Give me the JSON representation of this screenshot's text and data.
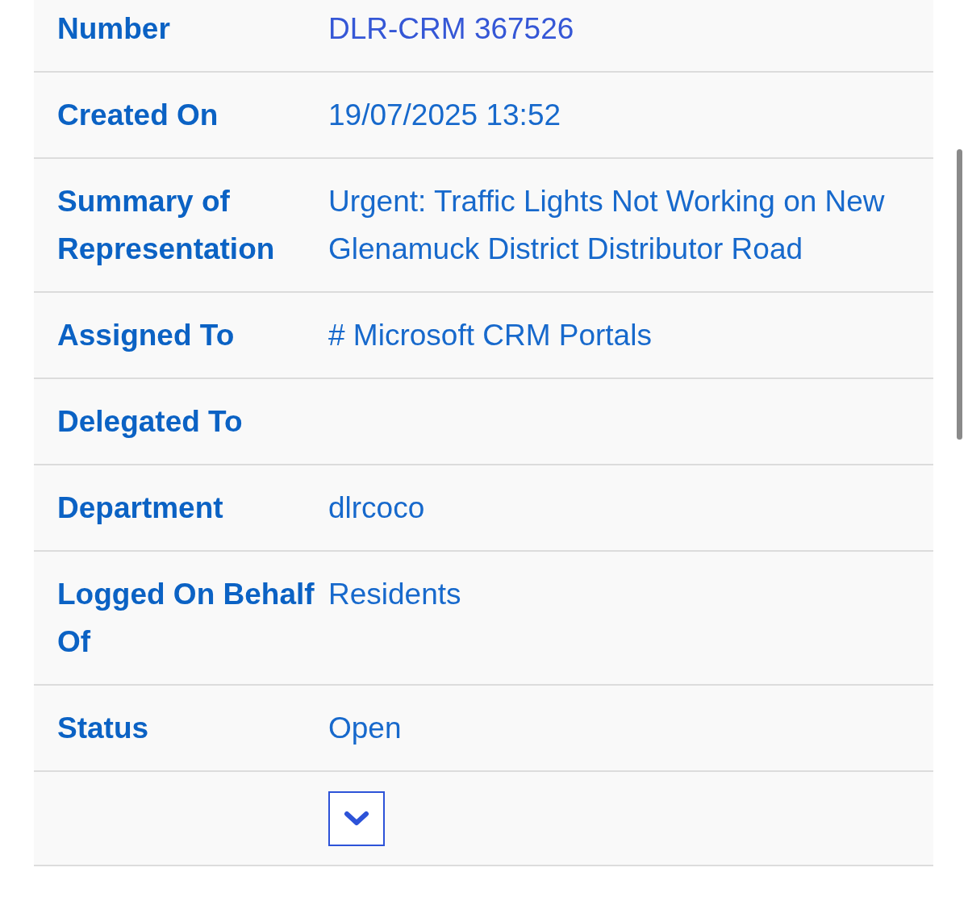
{
  "details": {
    "rows": [
      {
        "kind": "link",
        "label": "Number",
        "value": "DLR-CRM 367526"
      },
      {
        "kind": "text",
        "label": "Created On",
        "value": "19/07/2025 13:52"
      },
      {
        "kind": "text",
        "label": "Summary of Representation",
        "value": "Urgent: Traffic Lights Not Working on New Glenamuck District Distributor Road"
      },
      {
        "kind": "text",
        "label": "Assigned To",
        "value": "# Microsoft CRM Portals"
      },
      {
        "kind": "text",
        "label": "Delegated To"
      },
      {
        "kind": "text",
        "label": "Department",
        "value": "dlrcoco"
      },
      {
        "kind": "text",
        "label": "Logged On Behalf Of",
        "value": "Residents"
      },
      {
        "kind": "text",
        "label": "Status",
        "value": "Open"
      },
      {
        "kind": "toggle",
        "expanded": false
      }
    ]
  }
}
